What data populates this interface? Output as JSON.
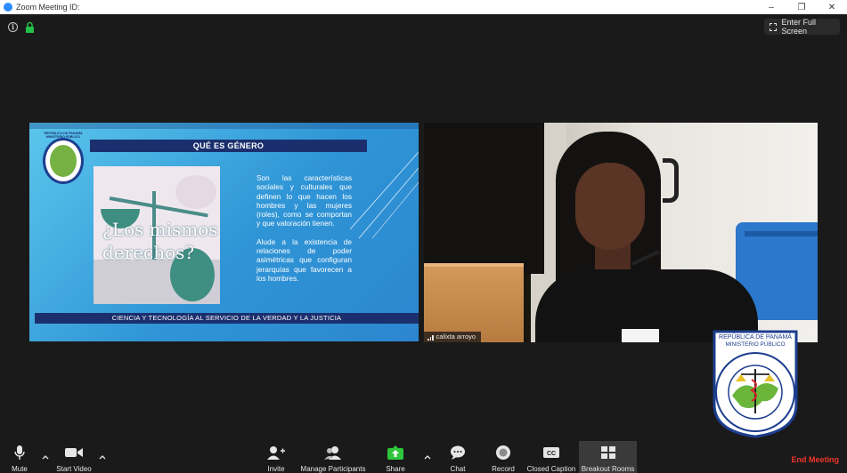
{
  "window": {
    "title": "Zoom Meeting ID:",
    "controls": [
      "–",
      "❐",
      "✕"
    ]
  },
  "top_bar": {
    "full_screen_label": "Enter Full Screen"
  },
  "shared_slide": {
    "emblem_text": "REPÚBLICA DE PANAMÁ MINISTERIO PÚBLICO",
    "header": "QUÉ ES GÉNERO",
    "image_text_line1": "¿Los mismos",
    "image_text_line2": "derechos?",
    "paragraph1": "Son las características sociales y culturales que definen lo que hacen los hombres y las mujeres (roles), como se comportan y que valoración tienen.",
    "paragraph2": "Alude a la existencia de relaciones de poder asimétricas que configuran jerarquías que favorecen a los hombres.",
    "footer": "CIENCIA Y TECNOLOGÍA AL SERVICIO DE LA VERDAD Y LA JUSTICIA"
  },
  "video": {
    "participant_name": "calixta arroyo"
  },
  "seal": {
    "line1": "REPÚBLICA DE PANAMÁ",
    "line2": "MINISTERIO PÚBLICO",
    "ring_text": "INSTITUTO DE MEDICINA LEGAL Y CIENCIAS FORENSES"
  },
  "toolbar": {
    "mute": "Mute",
    "start_video": "Start Video",
    "invite": "Invite",
    "manage_participants": "Manage Participants",
    "share": "Share",
    "chat": "Chat",
    "record": "Record",
    "closed_caption": "Closed Caption",
    "breakout_rooms": "Breakout Rooms",
    "end_meeting": "End Meeting",
    "colors": {
      "share_green": "#2dc53b",
      "end_red": "#f0362c"
    }
  }
}
